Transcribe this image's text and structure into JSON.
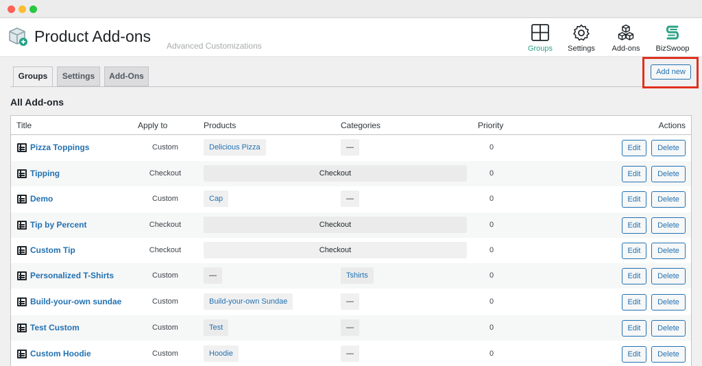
{
  "app": {
    "title": "Product Add-ons",
    "subtitle": "Advanced Customizations"
  },
  "nav": {
    "groups": "Groups",
    "settings": "Settings",
    "addons": "Add-ons",
    "bizswoop": "BizSwoop"
  },
  "icons": {
    "logo": "box-plus-icon",
    "groups": "grid-icon",
    "settings": "gear-icon",
    "addons": "cubes-icon",
    "bizswoop": "bizswoop-logo-icon",
    "row": "list-item-icon"
  },
  "colors": {
    "accent": "#2aa286",
    "link": "#2271b1",
    "highlight": "#e0301e"
  },
  "tabs": {
    "groups": "Groups",
    "settings": "Settings",
    "addons": "Add-Ons",
    "active": "Groups"
  },
  "actions": {
    "add_new": "Add new"
  },
  "section": {
    "heading": "All Add-ons"
  },
  "table": {
    "headers": {
      "title": "Title",
      "apply": "Apply to",
      "products": "Products",
      "categories": "Categories",
      "priority": "Priority",
      "actions": "Actions"
    },
    "edit_label": "Edit",
    "delete_label": "Delete",
    "rows": [
      {
        "title": "Pizza Toppings",
        "apply": "Custom",
        "product": "Delicious Pizza",
        "category": "—",
        "priority": "0"
      },
      {
        "title": "Tipping",
        "apply": "Checkout",
        "checkout": "Checkout",
        "priority": "0"
      },
      {
        "title": "Demo",
        "apply": "Custom",
        "product": "Cap",
        "category": "—",
        "priority": "0"
      },
      {
        "title": "Tip by Percent",
        "apply": "Checkout",
        "checkout": "Checkout",
        "priority": "0"
      },
      {
        "title": "Custom Tip",
        "apply": "Checkout",
        "checkout": "Checkout",
        "priority": "0"
      },
      {
        "title": "Personalized T-Shirts",
        "apply": "Custom",
        "product": "—",
        "category": "Tshirts",
        "priority": "0"
      },
      {
        "title": "Build-your-own sundae",
        "apply": "Custom",
        "product": "Build-your-own Sundae",
        "category": "—",
        "priority": "0"
      },
      {
        "title": "Test Custom",
        "apply": "Custom",
        "product": "Test",
        "category": "—",
        "priority": "0"
      },
      {
        "title": "Custom Hoodie",
        "apply": "Custom",
        "product": "Hoodie",
        "category": "—",
        "priority": "0"
      }
    ]
  }
}
